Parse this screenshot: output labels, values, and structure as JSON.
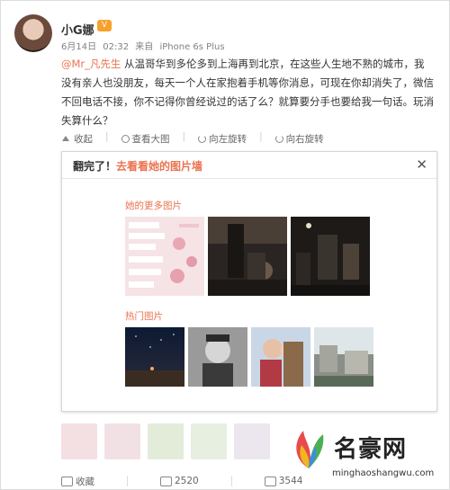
{
  "user": {
    "name": "小G娜",
    "badge": "ᐦ",
    "date": "6月14日",
    "time": "02:32",
    "source_prefix": "来自",
    "device": "iPhone 6s Plus"
  },
  "post": {
    "mention": "@Mr_凡先生",
    "text": " 从温哥华到多伦多到上海再到北京，在这些人生地不熟的城市，我没有亲人也没朋友，每天一个人在家抱着手机等你消息，可现在你却消失了，微信不回电话不接，你不记得你曾经说过的话了么？就算要分手也要给我一句话。玩消失算什么？"
  },
  "actions": {
    "collapse": "收起",
    "view_large": "查看大图",
    "rotate_left": "向左旋转",
    "rotate_right": "向右旋转"
  },
  "popup": {
    "title_prefix": "翻完了！",
    "title_link": "去看看她的图片墙",
    "close": "✕",
    "more_label": "她的更多图片",
    "hot_label": "热门图片"
  },
  "footer": {
    "favorite": "收藏",
    "repost_count": "2520",
    "comment_count": "3544"
  },
  "watermark": {
    "name": "名豪网",
    "url": "minghaoshangwu.com"
  }
}
